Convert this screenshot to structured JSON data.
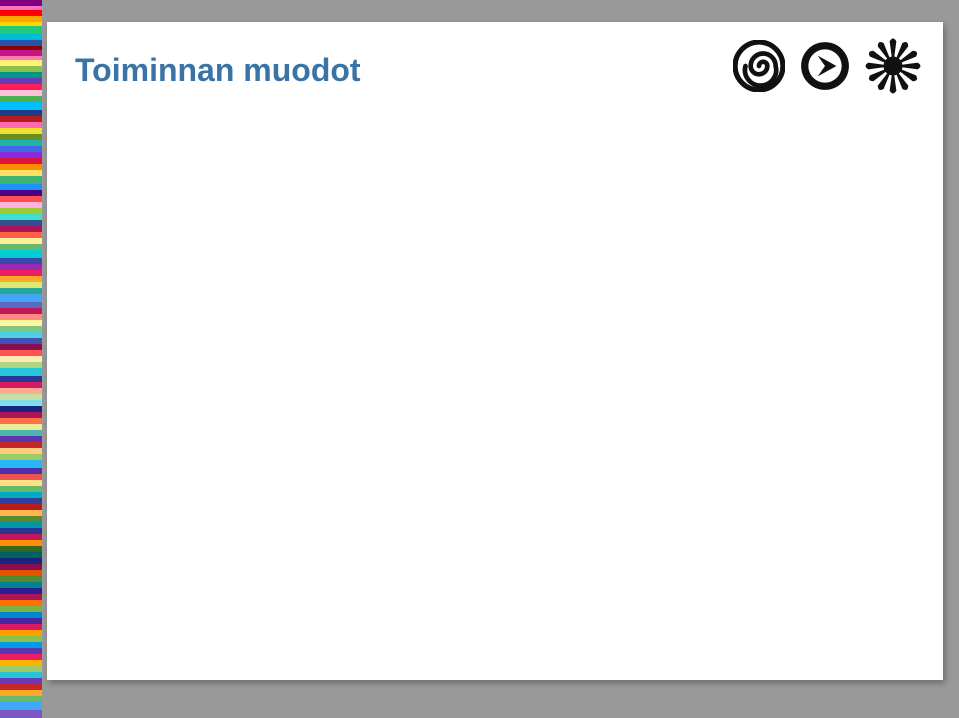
{
  "slide": {
    "title": "Toiminnan muodot"
  },
  "icons": {
    "spiral": "spiral-icon",
    "arrow": "arrow-circle-icon",
    "sun": "sun-icon"
  }
}
